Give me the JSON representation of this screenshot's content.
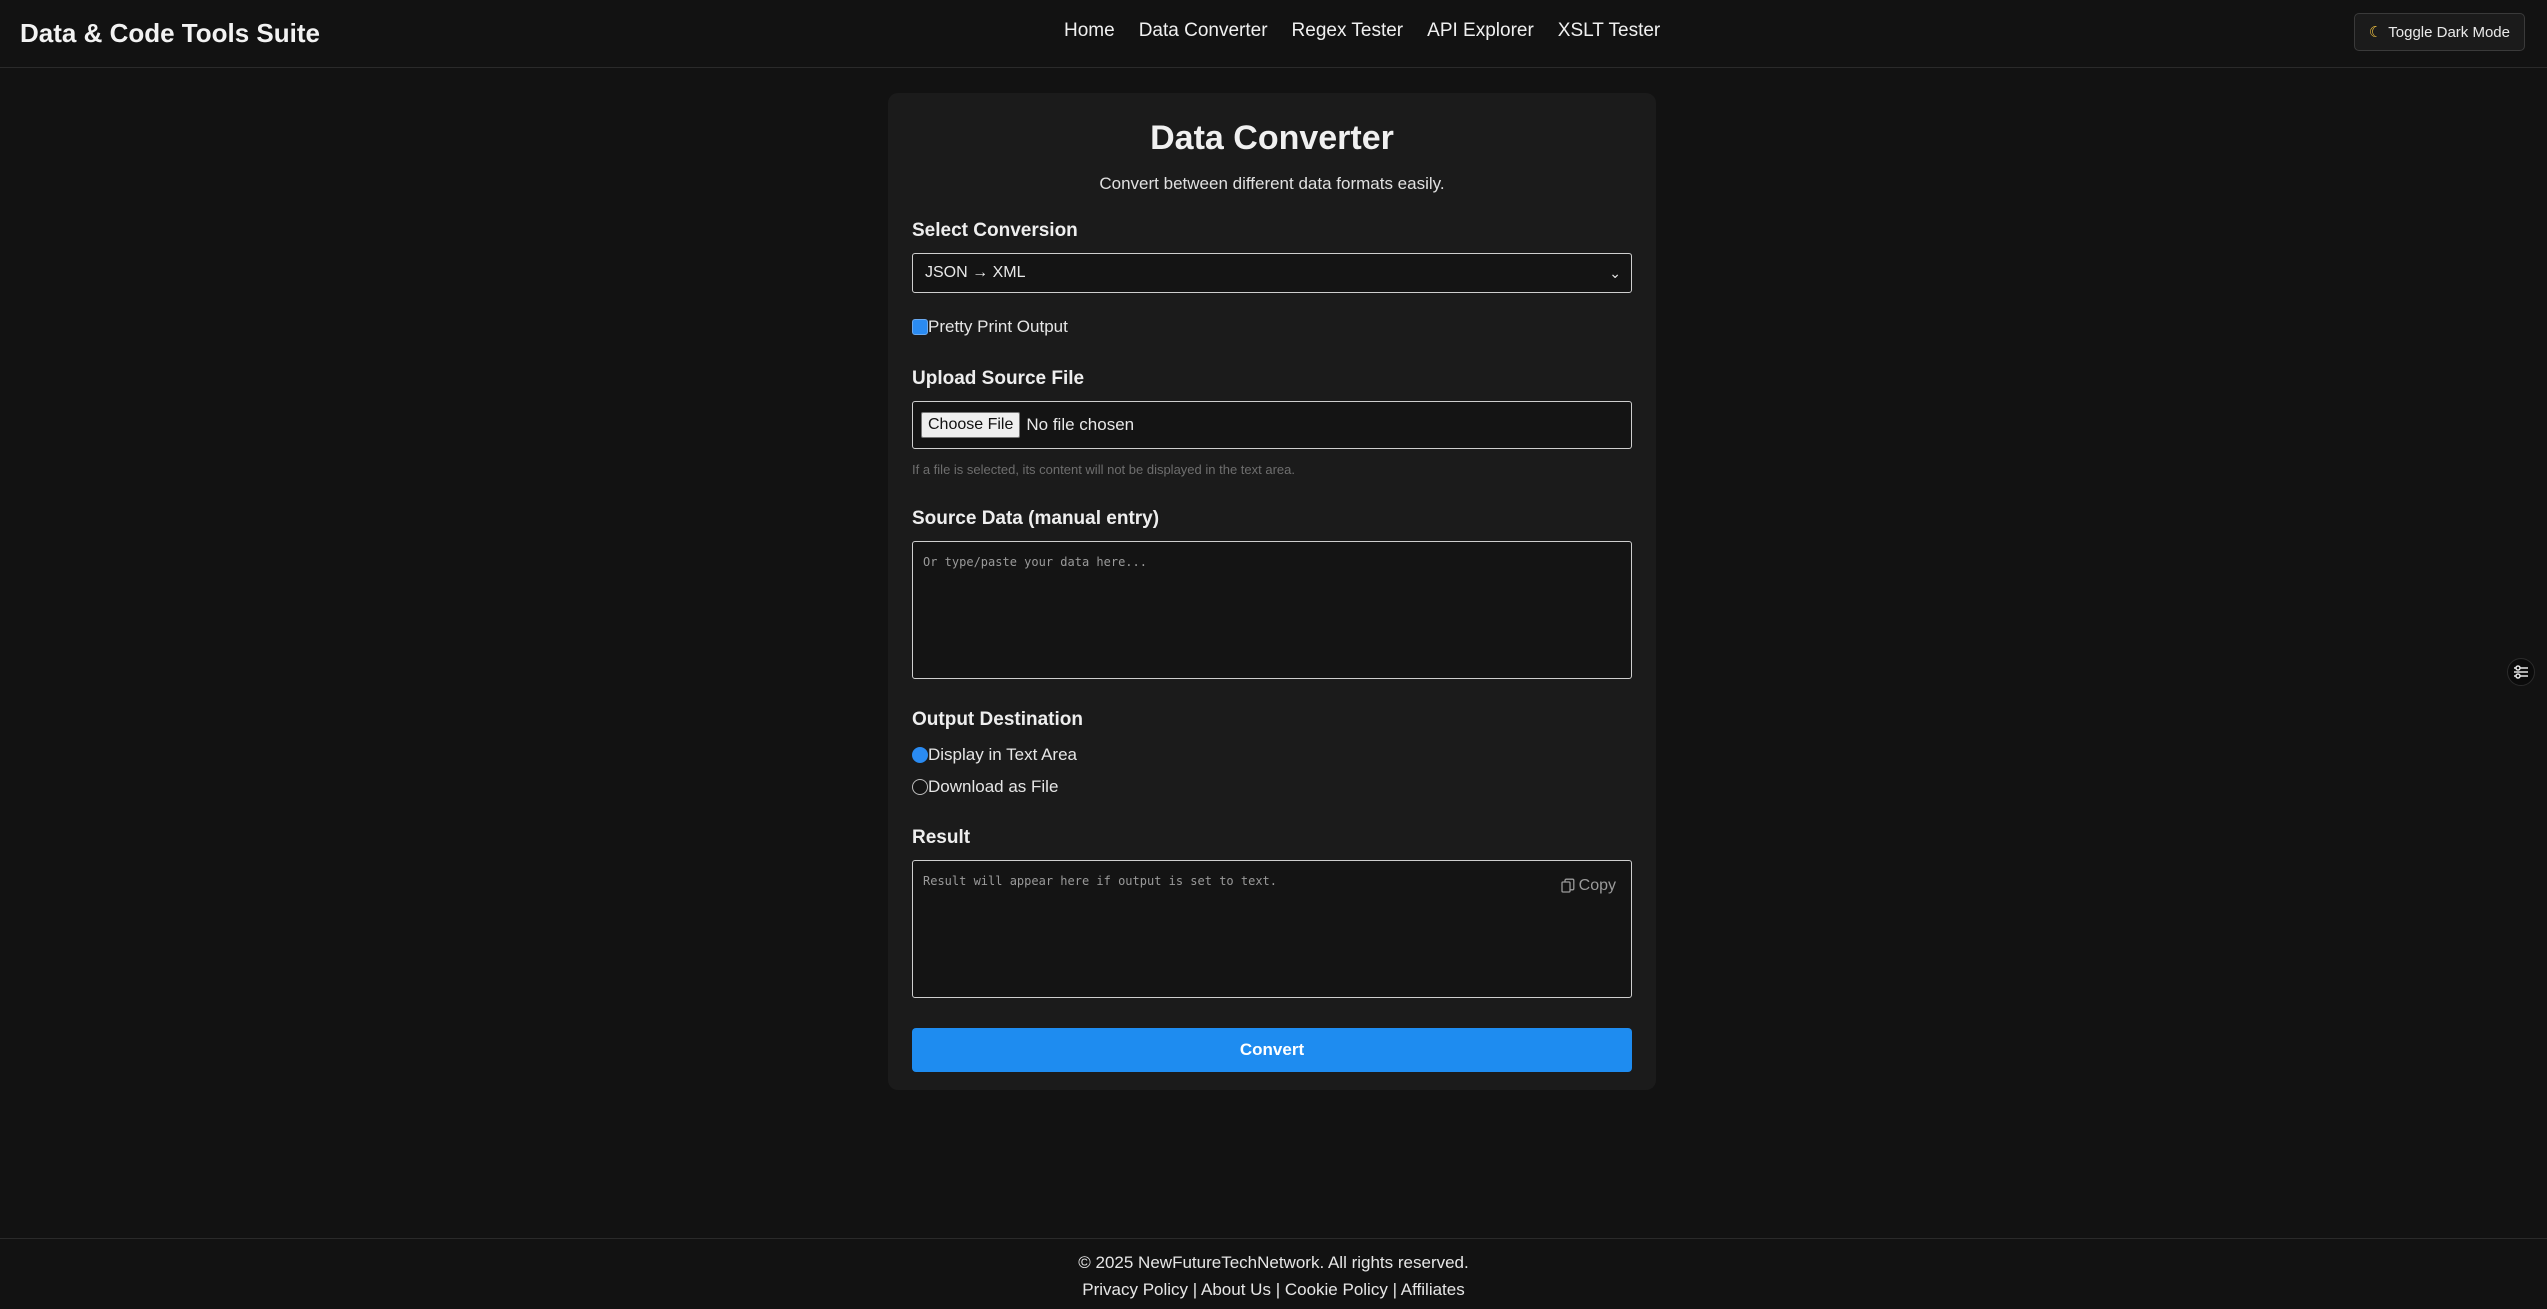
{
  "header": {
    "brand": "Data & Code Tools Suite",
    "nav": [
      "Home",
      "Data Converter",
      "Regex Tester",
      "API Explorer",
      "XSLT Tester"
    ],
    "theme_toggle": "Toggle Dark Mode",
    "theme_icon": "moon-icon"
  },
  "converter": {
    "title": "Data Converter",
    "subtitle": "Convert between different data formats easily.",
    "select_label": "Select Conversion",
    "select_value": "JSON → XML",
    "pretty_print_label": "Pretty Print Output",
    "pretty_print_checked": true,
    "upload_label": "Upload Source File",
    "file_button": "Choose File",
    "file_status": "No file chosen",
    "upload_hint": "If a file is selected, its content will not be displayed in the text area.",
    "source_label": "Source Data (manual entry)",
    "source_placeholder": "Or type/paste your data here...",
    "output_label": "Output Destination",
    "output_options": [
      "Display in Text Area",
      "Download as File"
    ],
    "output_selected": "Display in Text Area",
    "result_label": "Result",
    "result_placeholder": "Result will appear here if output is set to text.",
    "copy_label": "Copy",
    "convert_button": "Convert"
  },
  "footer": {
    "copyright": "© 2025 NewFutureTechNetwork. All rights reserved.",
    "links": [
      "Privacy Policy",
      "About Us",
      "Cookie Policy",
      "Affiliates"
    ],
    "separator": "|"
  },
  "colors": {
    "background": "#121212",
    "card": "#1b1b1b",
    "accent": "#1e8cf0"
  }
}
